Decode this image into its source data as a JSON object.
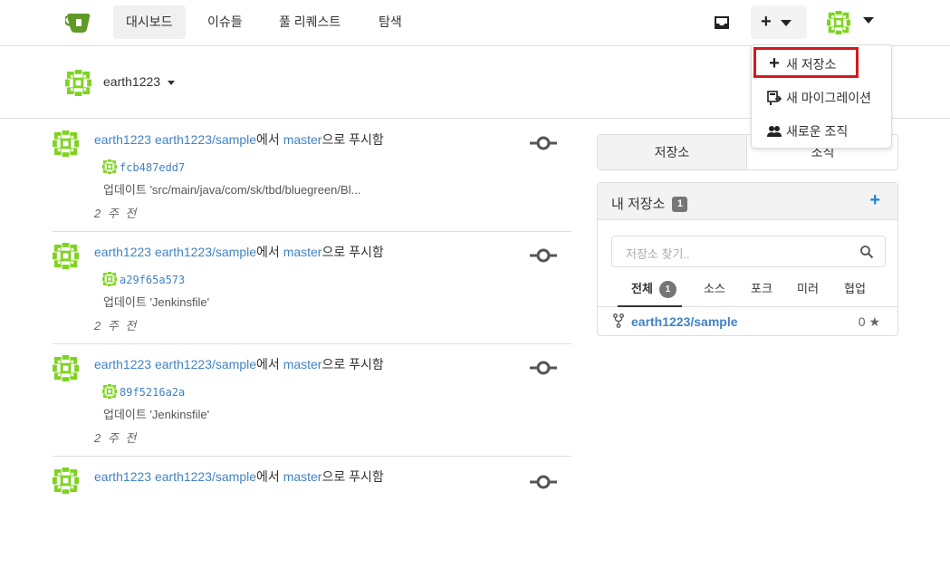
{
  "navbar": {
    "items": [
      {
        "label": "대시보드",
        "active": true
      },
      {
        "label": "이슈들"
      },
      {
        "label": "풀 리퀘스트"
      },
      {
        "label": "탐색"
      }
    ],
    "create_symbol": "+"
  },
  "create_menu": {
    "items": [
      {
        "icon": "plus-icon",
        "symbol": "+",
        "label": "새 저장소",
        "highlighted": true
      },
      {
        "icon": "migration-icon",
        "label": "새 마이그레이션"
      },
      {
        "icon": "organization-icon",
        "label": "새로운 조직"
      }
    ]
  },
  "context": {
    "username": "earth1223"
  },
  "feed": [
    {
      "actor": "earth1223",
      "repo": "earth1223/sample",
      "mid": "에서",
      "branch": "master",
      "suffix": "으로 푸시함",
      "sha": "fcb487edd7",
      "message": "업데이트 'src/main/java/com/sk/tbd/bluegreen/Bl...",
      "time": "2 주 전"
    },
    {
      "actor": "earth1223",
      "repo": "earth1223/sample",
      "mid": "에서",
      "branch": "master",
      "suffix": "으로 푸시함",
      "sha": "a29f65a573",
      "message": "업데이트 'Jenkinsfile'",
      "time": "2 주 전"
    },
    {
      "actor": "earth1223",
      "repo": "earth1223/sample",
      "mid": "에서",
      "branch": "master",
      "suffix": "으로 푸시함",
      "sha": "89f5216a2a",
      "message": "업데이트 'Jenkinsfile'",
      "time": "2 주 전"
    },
    {
      "actor": "earth1223",
      "repo": "earth1223/sample",
      "mid": "에서",
      "branch": "master",
      "suffix": "으로 푸시함",
      "sha": "",
      "message": "",
      "time": ""
    }
  ],
  "right_panel": {
    "tabs": [
      {
        "label": "저장소",
        "active": true
      },
      {
        "label": "조직"
      }
    ],
    "repos": {
      "title": "내 저장소",
      "count": "1",
      "add_symbol": "+",
      "search_placeholder": "저장소 찾기..",
      "filters": [
        {
          "label": "전체",
          "count": "1",
          "active": true
        },
        {
          "label": "소스"
        },
        {
          "label": "포크"
        },
        {
          "label": "미러"
        },
        {
          "label": "협업"
        }
      ],
      "list": [
        {
          "name": "earth1223/sample",
          "stars": "0",
          "star_symbol": "★"
        }
      ]
    }
  },
  "colors": {
    "link": "#4183c4",
    "accent": "#2185d0",
    "highlight": "#d4191f",
    "avatar": "#7ed321"
  }
}
